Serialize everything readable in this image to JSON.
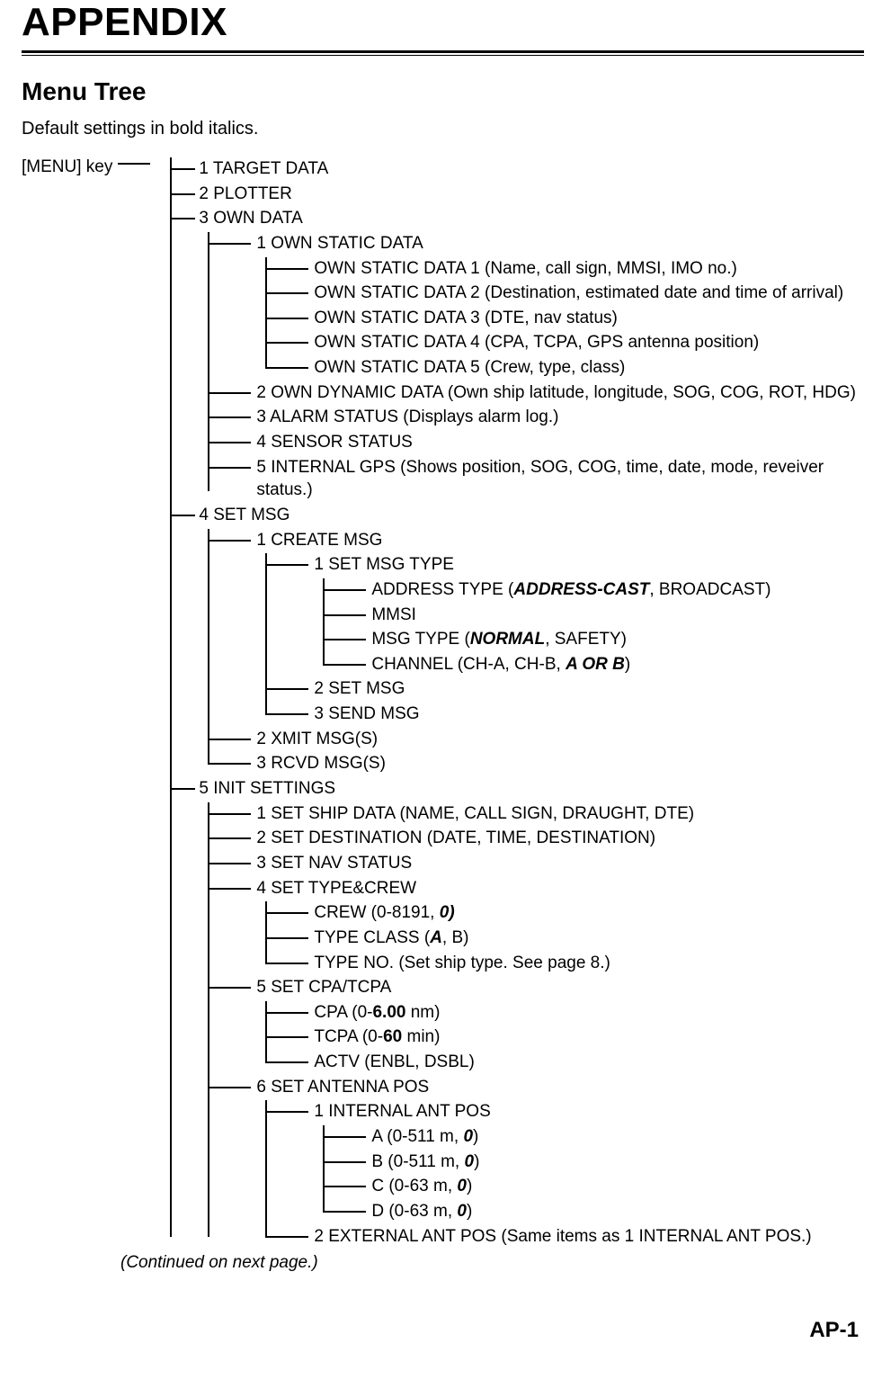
{
  "title": "APPENDIX",
  "section": "Menu Tree",
  "note": "Default settings in bold italics.",
  "root_label": "[MENU] key",
  "continued": "(Continued on next page.)",
  "pagenum": "AP-1",
  "tree": {
    "items": [
      {
        "t": "1 TARGET DATA"
      },
      {
        "t": "2 PLOTTER"
      },
      {
        "t": "3 OWN DATA",
        "children": [
          {
            "t": "1 OWN STATIC DATA",
            "children": [
              {
                "t": "OWN STATIC DATA 1 (Name, call sign, MMSI, IMO no.)"
              },
              {
                "t": "OWN STATIC DATA 2 (Destination, estimated date and time of arrival)"
              },
              {
                "t": "OWN STATIC DATA 3 (DTE, nav status)"
              },
              {
                "t": "OWN STATIC DATA 4 (CPA, TCPA, GPS antenna position)"
              },
              {
                "t": "OWN STATIC DATA 5 (Crew, type, class)"
              }
            ]
          },
          {
            "t": "2 OWN DYNAMIC DATA (Own ship latitude, longitude, SOG, COG, ROT, HDG)"
          },
          {
            "t": "3 ALARM STATUS (Displays alarm log.)"
          },
          {
            "t": "4 SENSOR STATUS"
          },
          {
            "t": "5  INTERNAL GPS (Shows position, SOG, COG, time, date, mode, reveiver status.)"
          }
        ]
      },
      {
        "t": "4 SET MSG",
        "children": [
          {
            "t": "1 CREATE MSG",
            "children": [
              {
                "t": "1 SET MSG TYPE",
                "children": [
                  {
                    "segments": [
                      {
                        "text": "ADDRESS TYPE ("
                      },
                      {
                        "text": "ADDRESS-CAST",
                        "cls": "bi"
                      },
                      {
                        "text": ", BROADCAST)"
                      }
                    ]
                  },
                  {
                    "t": "MMSI"
                  },
                  {
                    "segments": [
                      {
                        "text": "MSG TYPE ("
                      },
                      {
                        "text": "NORMAL",
                        "cls": "bi"
                      },
                      {
                        "text": ", SAFETY)"
                      }
                    ]
                  },
                  {
                    "segments": [
                      {
                        "text": "CHANNEL (CH-A, CH-B, "
                      },
                      {
                        "text": "A OR B",
                        "cls": "bi"
                      },
                      {
                        "text": ")"
                      }
                    ]
                  }
                ]
              },
              {
                "t": "2 SET MSG"
              },
              {
                "t": "3 SEND MSG"
              }
            ]
          },
          {
            "t": "2 XMIT MSG(S)"
          },
          {
            "t": "3 RCVD MSG(S)"
          }
        ]
      },
      {
        "t": "5 INIT SETTINGS",
        "children": [
          {
            "t": "1 SET SHIP DATA (NAME, CALL SIGN, DRAUGHT, DTE)"
          },
          {
            "t": "2 SET DESTINATION (DATE, TIME, DESTINATION)"
          },
          {
            "t": "3 SET NAV STATUS"
          },
          {
            "t": "4 SET TYPE&CREW",
            "children": [
              {
                "segments": [
                  {
                    "text": "CREW (0-8191, "
                  },
                  {
                    "text": "0",
                    "cls": "bi"
                  },
                  {
                    "text": ")",
                    "cls": "bi"
                  }
                ]
              },
              {
                "segments": [
                  {
                    "text": "TYPE CLASS ("
                  },
                  {
                    "text": "A",
                    "cls": "bi"
                  },
                  {
                    "text": ", B)"
                  }
                ]
              },
              {
                "t": "TYPE NO. (Set ship type. See page 8.)"
              }
            ]
          },
          {
            "t": "5 SET CPA/TCPA",
            "children": [
              {
                "segments": [
                  {
                    "text": "CPA (0-"
                  },
                  {
                    "text": "6.00",
                    "cls": "b"
                  },
                  {
                    "text": " nm)"
                  }
                ]
              },
              {
                "segments": [
                  {
                    "text": "TCPA (0-"
                  },
                  {
                    "text": "60",
                    "cls": "b"
                  },
                  {
                    "text": " min)"
                  }
                ]
              },
              {
                "t": "ACTV (ENBL, DSBL)"
              }
            ]
          },
          {
            "t": "6 SET ANTENNA POS",
            "children": [
              {
                "t": "1 INTERNAL ANT POS",
                "children": [
                  {
                    "segments": [
                      {
                        "text": "A (0-511 m, "
                      },
                      {
                        "text": "0",
                        "cls": "bi"
                      },
                      {
                        "text": ")"
                      }
                    ]
                  },
                  {
                    "segments": [
                      {
                        "text": "B (0-511 m, "
                      },
                      {
                        "text": "0",
                        "cls": "bi"
                      },
                      {
                        "text": ")"
                      }
                    ]
                  },
                  {
                    "segments": [
                      {
                        "text": "C (0-63 m, "
                      },
                      {
                        "text": "0",
                        "cls": "bi"
                      },
                      {
                        "text": ")"
                      }
                    ]
                  },
                  {
                    "segments": [
                      {
                        "text": "D (0-63 m, "
                      },
                      {
                        "text": "0",
                        "cls": "bi"
                      },
                      {
                        "text": ")"
                      }
                    ]
                  }
                ]
              },
              {
                "t": "2 EXTERNAL ANT POS (Same items as 1 INTERNAL ANT POS.)"
              }
            ]
          }
        ]
      }
    ]
  }
}
